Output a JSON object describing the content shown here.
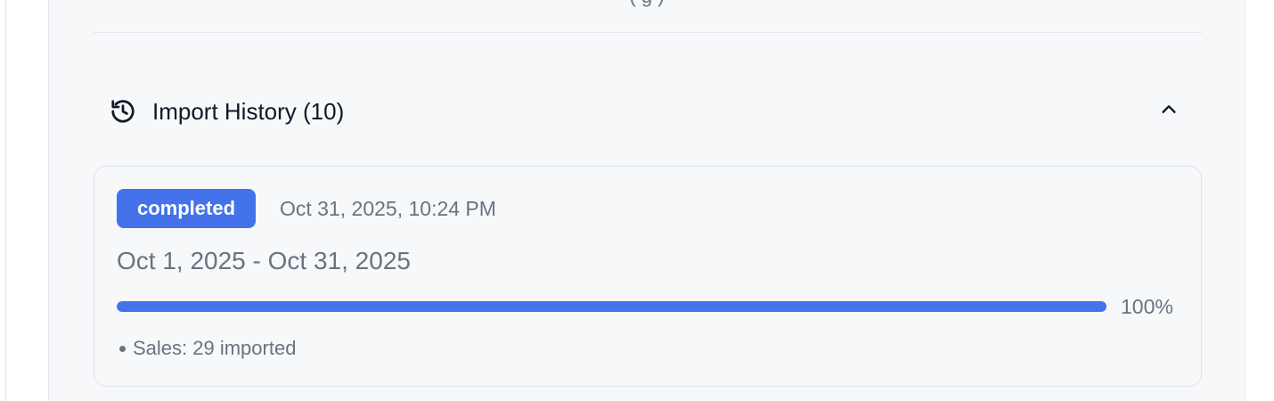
{
  "top_clipped_text": "(  g  )",
  "history": {
    "title": "Import History (10)",
    "icon": "history-icon",
    "toggle_icon": "chevron-up-icon"
  },
  "imports": [
    {
      "status": "completed",
      "timestamp": "Oct 31, 2025, 10:24 PM",
      "date_range": "Oct 1, 2025 - Oct 31, 2025",
      "progress_percent": 100,
      "progress_label": "100%",
      "results": [
        "Sales: 29 imported"
      ]
    }
  ],
  "colors": {
    "accent": "#4472ea",
    "muted_text": "#6b7280",
    "panel_bg": "#f7f8fa",
    "border": "#dfe3ea"
  }
}
